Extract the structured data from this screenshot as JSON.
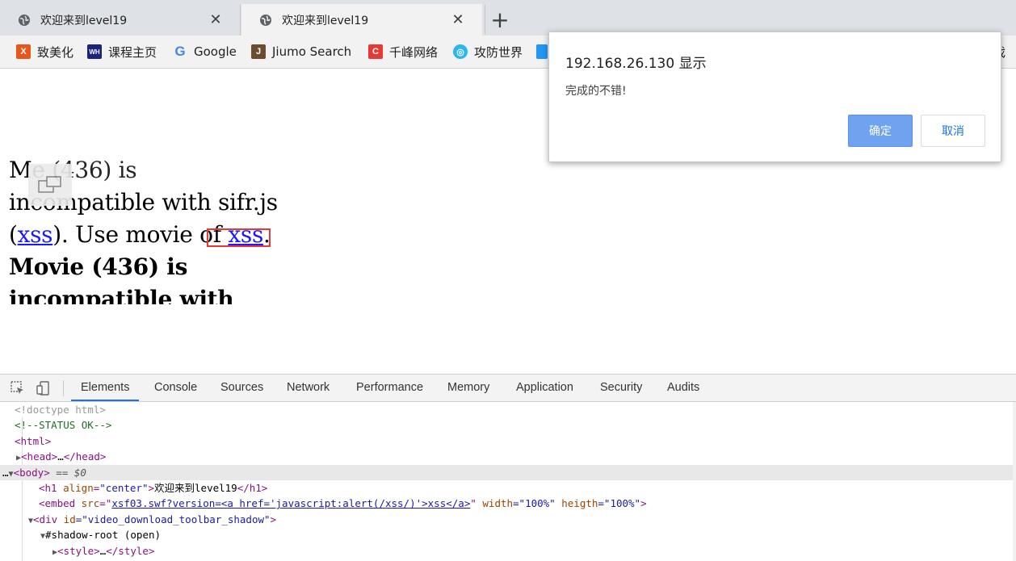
{
  "tabs": [
    {
      "title": "欢迎来到level19",
      "close": "✕",
      "active": false
    },
    {
      "title": "欢迎来到level19",
      "close": "✕",
      "active": true
    }
  ],
  "new_tab": "+",
  "bookmarks": [
    {
      "label": "致美化",
      "icon": "zhimeihua-icon",
      "badge": "X",
      "color": "#e8561c"
    },
    {
      "label": "课程主页",
      "icon": "wh-icon",
      "badge": "WH",
      "color": "#1a237e"
    },
    {
      "label": "Google",
      "icon": "google-icon",
      "badge": "G",
      "color": "#4285f4"
    },
    {
      "label": "Jiumo Search",
      "icon": "jiumo-icon",
      "badge": "J",
      "color": "#6d4c2e"
    },
    {
      "label": "千峰网络",
      "icon": "qianfeng-icon",
      "badge": "C",
      "color": "#e53935"
    },
    {
      "label": "攻防世界",
      "icon": "gongfang-icon",
      "badge": "◎",
      "color": "#29b6f6"
    }
  ],
  "bookmark_overflow": "戏",
  "page": {
    "line1_pre": "M",
    "line1_post": "e (436) is",
    "line2": "incompatible with sifr.js",
    "line3_open": "(",
    "line3_link1": "xss",
    "line3_mid": "). Use movie of ",
    "line3_link2": "xss",
    "line3_end": ".",
    "line4": "Movie (436) is",
    "line5": "incompatible with sifr.js"
  },
  "dialog": {
    "title": "192.168.26.130 显示",
    "message": "完成的不错!",
    "ok": "确定",
    "cancel": "取消"
  },
  "devtools": {
    "tabs": [
      "Elements",
      "Console",
      "Sources",
      "Network",
      "Performance",
      "Memory",
      "Application",
      "Security",
      "Audits"
    ],
    "active_tab": "Elements",
    "dom": {
      "doctype": "<!doctype html>",
      "comment": "<!--STATUS OK-->",
      "html_open": "<html>",
      "head_open": "<head>",
      "head_ellipsis": "…",
      "head_close": "</head>",
      "body_tag": "<body>",
      "body_marker": " == $0",
      "h1_open": "<h1",
      "h1_attr": " align",
      "h1_eq": "=",
      "h1_val": "\"center\"",
      "h1_gt": ">",
      "h1_text": "欢迎来到level19",
      "h1_close": "</h1>",
      "embed_open": "<embed",
      "embed_attr_src": " src",
      "embed_eq": "=\"",
      "embed_src": "xsf03.swf?version=<a href='javascript:alert(/xss/)'>xss</a>",
      "embed_q": "\"",
      "embed_attr_w": " width",
      "embed_val_w": "=\"100%\"",
      "embed_attr_h": " heigth",
      "embed_val_h": "=\"100%\"",
      "embed_gt": ">",
      "div_open": "<div",
      "div_attr": " id",
      "div_val": "=\"video_download_toolbar_shadow\"",
      "div_gt": ">",
      "shadow_root": "#shadow-root (open)",
      "style_open": "<style>",
      "style_ellipsis": "…",
      "style_close": "</style>"
    }
  }
}
